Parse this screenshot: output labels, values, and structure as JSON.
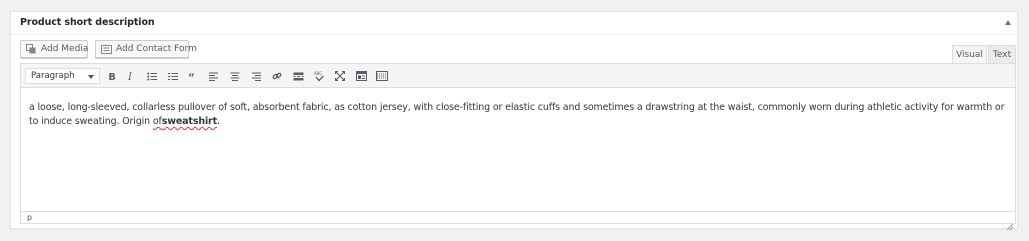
{
  "metabox": {
    "title": "Product short description"
  },
  "media_buttons": {
    "add_media": "Add Media",
    "add_contact_form": "Add Contact Form"
  },
  "editor_tabs": {
    "visual": "Visual",
    "text": "Text"
  },
  "toolbar": {
    "format": "Paragraph",
    "icons": [
      "bold-icon",
      "italic-icon",
      "bullet-list-icon",
      "numbered-list-icon",
      "blockquote-icon",
      "align-left-icon",
      "align-center-icon",
      "align-right-icon",
      "link-icon",
      "read-more-icon",
      "spellcheck-icon",
      "fullscreen-icon",
      "toolbar-toggle-icon",
      "keyboard-icon"
    ]
  },
  "content": {
    "text_before": "a loose, long-sleeved, collarless pullover of soft, absorbent fabric, as cotton jersey, with close-fitting or elastic cuffs and sometimes a drawstring at the waist, commonly worn during athletic activity for warmth or to induce sweating. Origin ",
    "underlined_word": "of",
    "bold_word": "sweatshirt",
    "text_after": "."
  },
  "statusbar": {
    "path": "p"
  }
}
